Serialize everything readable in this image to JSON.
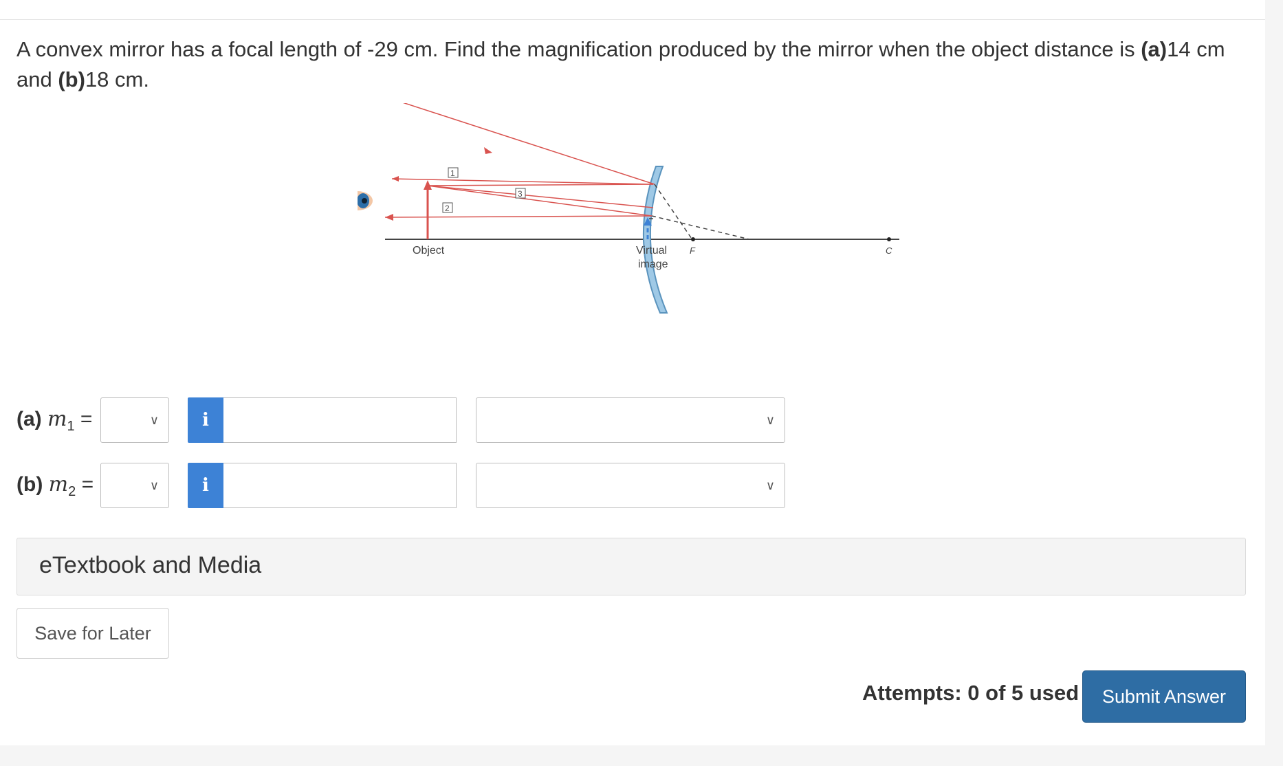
{
  "question": {
    "text_before": "A convex mirror has a focal length of -29 cm. Find the magnification produced by the mirror when the object distance is ",
    "part_a_marker": "(a)",
    "part_a_value": "14 cm",
    "middle": " and ",
    "part_b_marker": "(b)",
    "part_b_value": "18 cm."
  },
  "figure": {
    "object_label": "Object",
    "virtual_label_line1": "Virtual",
    "virtual_label_line2": "image",
    "f_label": "F",
    "c_label": "C",
    "ray_numbers": [
      "1",
      "2",
      "3"
    ],
    "colors": {
      "ray": "#d9534f",
      "mirror": "#9fc9e6",
      "image_arrow": "#3d82d6",
      "axis": "#444444"
    }
  },
  "answers": [
    {
      "part": "(a)",
      "var": "m",
      "sub": "1",
      "eq": " =",
      "sign_value": "",
      "value": "",
      "unit_value": "",
      "info_icon": "i"
    },
    {
      "part": "(b)",
      "var": "m",
      "sub": "2",
      "eq": " =",
      "sign_value": "",
      "value": "",
      "unit_value": "",
      "info_icon": "i"
    }
  ],
  "etextbook": {
    "label": "eTextbook and Media"
  },
  "footer": {
    "save_label": "Save for Later",
    "attempts": "Attempts: 0 of 5 used",
    "submit_label": "Submit Answer"
  }
}
